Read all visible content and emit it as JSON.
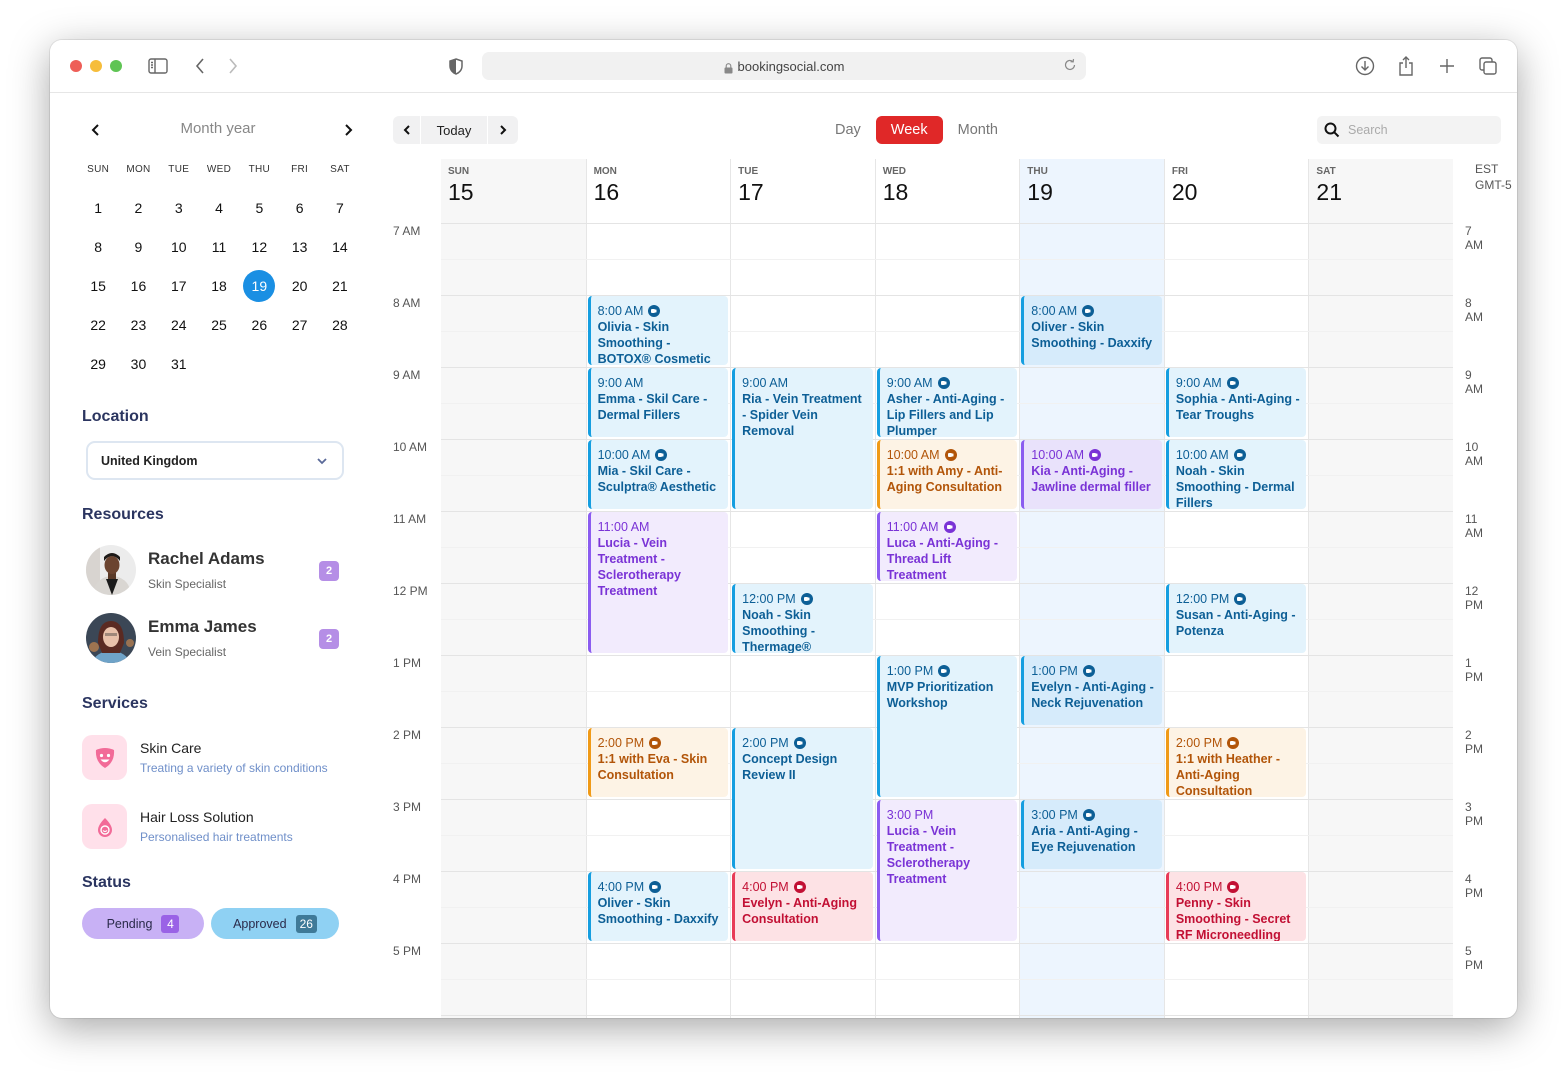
{
  "browser": {
    "url": "bookingsocial.com",
    "traffic_lights": {
      "close": "#ee5e57",
      "minimize": "#f6bd3b",
      "maximize": "#5fc454"
    }
  },
  "mini_calendar": {
    "title": "Month year",
    "weekdays": [
      "SUN",
      "MON",
      "TUE",
      "WED",
      "THU",
      "FRI",
      "SAT"
    ],
    "days": [
      "1",
      "2",
      "3",
      "4",
      "5",
      "6",
      "7",
      "8",
      "9",
      "10",
      "11",
      "12",
      "13",
      "14",
      "15",
      "16",
      "17",
      "18",
      "19",
      "20",
      "21",
      "22",
      "23",
      "24",
      "25",
      "26",
      "27",
      "28",
      "29",
      "30",
      "31"
    ],
    "selected_day": "19",
    "accent": "#1a8fe3"
  },
  "location": {
    "title": "Location",
    "selected": "United Kingdom"
  },
  "resources": {
    "title": "Resources",
    "items": [
      {
        "name": "Rachel Adams",
        "role": "Skin Specialist",
        "count": "2"
      },
      {
        "name": "Emma James",
        "role": "Vein Specialist",
        "count": "2"
      }
    ]
  },
  "services": {
    "title": "Services",
    "items": [
      {
        "name": "Skin Care",
        "description": "Treating a variety of skin conditions",
        "icon": "face-mask-icon"
      },
      {
        "name": "Hair Loss Solution",
        "description": "Personalised hair treatments",
        "icon": "droplet-face-icon"
      }
    ]
  },
  "status": {
    "title": "Status",
    "pending": {
      "label": "Pending",
      "count": "4",
      "color": "#c8b1f5"
    },
    "approved": {
      "label": "Approved",
      "count": "26",
      "color": "#8fd1f3"
    }
  },
  "toolbar": {
    "today_label": "Today",
    "views": [
      "Day",
      "Week",
      "Month"
    ],
    "active_view": "Week",
    "search_placeholder": "Search"
  },
  "week": {
    "timezone": [
      "EST",
      "GMT-5"
    ],
    "days": [
      {
        "dow": "SUN",
        "num": "15"
      },
      {
        "dow": "MON",
        "num": "16"
      },
      {
        "dow": "TUE",
        "num": "17"
      },
      {
        "dow": "WED",
        "num": "18"
      },
      {
        "dow": "THU",
        "num": "19"
      },
      {
        "dow": "FRI",
        "num": "20"
      },
      {
        "dow": "SAT",
        "num": "21"
      }
    ],
    "today_index": 4,
    "hours": [
      "7 AM",
      "8 AM",
      "9 AM",
      "10 AM",
      "11 AM",
      "12 PM",
      "1 PM",
      "2 PM",
      "3 PM",
      "4 PM",
      "5 PM"
    ],
    "events": [
      {
        "day": 1,
        "start": 8,
        "end": 9,
        "time": "8:00 AM",
        "video": true,
        "title": "Olivia - Skin Smoothing - BOTOX® Cosmetic",
        "style": "blue"
      },
      {
        "day": 1,
        "start": 9,
        "end": 10,
        "time": "9:00 AM",
        "video": false,
        "title": "Emma - Skil Care - Dermal Fillers",
        "style": "blue"
      },
      {
        "day": 1,
        "start": 10,
        "end": 11,
        "time": "10:00 AM",
        "video": true,
        "title": "Mia - Skil Care - Sculptra® Aesthetic",
        "style": "blue"
      },
      {
        "day": 1,
        "start": 11,
        "end": 13,
        "time": "11:00 AM",
        "video": false,
        "title": "Lucia - Vein Treatment - Sclerotherapy Treatment",
        "style": "purple"
      },
      {
        "day": 1,
        "start": 14,
        "end": 15,
        "time": "2:00 PM",
        "video": true,
        "title": "1:1 with Eva - Skin Consultation",
        "style": "orange"
      },
      {
        "day": 1,
        "start": 16,
        "end": 17,
        "time": "4:00 PM",
        "video": true,
        "title": "Oliver - Skin Smoothing - Daxxify",
        "style": "blue"
      },
      {
        "day": 2,
        "start": 9,
        "end": 11,
        "time": "9:00 AM",
        "video": false,
        "title": "Ria - Vein Treatment - Spider Vein Removal",
        "style": "blue"
      },
      {
        "day": 2,
        "start": 12,
        "end": 13,
        "time": "12:00 PM",
        "video": true,
        "title": "Noah - Skin Smoothing - Thermage®",
        "style": "blue"
      },
      {
        "day": 2,
        "start": 14,
        "end": 16,
        "time": "2:00 PM",
        "video": true,
        "title": "Concept Design Review II",
        "style": "blue"
      },
      {
        "day": 2,
        "start": 16,
        "end": 17,
        "time": "4:00 PM",
        "video": true,
        "title": "Evelyn - Anti-Aging Consultation",
        "style": "red"
      },
      {
        "day": 3,
        "start": 9,
        "end": 10,
        "time": "9:00 AM",
        "video": true,
        "title": "Asher - Anti-Aging - Lip Fillers and Lip Plumper",
        "style": "blue"
      },
      {
        "day": 3,
        "start": 10,
        "end": 11,
        "time": "10:00 AM",
        "video": true,
        "title": "1:1 with Amy - Anti-Aging Consultation",
        "style": "orange"
      },
      {
        "day": 3,
        "start": 11,
        "end": 12,
        "time": "11:00 AM",
        "video": true,
        "title": "Luca - Anti-Aging - Thread Lift Treatment",
        "style": "purple"
      },
      {
        "day": 3,
        "start": 13,
        "end": 15,
        "time": "1:00 PM",
        "video": true,
        "title": "MVP Prioritization Workshop",
        "style": "blue"
      },
      {
        "day": 3,
        "start": 15,
        "end": 17,
        "time": "3:00 PM",
        "video": false,
        "title": "Lucia - Vein Treatment - Sclerotherapy Treatment",
        "style": "purple"
      },
      {
        "day": 4,
        "start": 8,
        "end": 9,
        "time": "8:00 AM",
        "video": true,
        "title": "Oliver - Skin Smoothing - Daxxify",
        "style": "blue2"
      },
      {
        "day": 4,
        "start": 10,
        "end": 11,
        "time": "10:00 AM",
        "video": true,
        "title": "Kia - Anti-Aging - Jawline dermal filler",
        "style": "purple2"
      },
      {
        "day": 4,
        "start": 13,
        "end": 14,
        "time": "1:00 PM",
        "video": true,
        "title": "Evelyn - Anti-Aging - Neck Rejuvenation",
        "style": "blue2"
      },
      {
        "day": 4,
        "start": 15,
        "end": 16,
        "time": "3:00 PM",
        "video": true,
        "title": "Aria - Anti-Aging - Eye Rejuvenation",
        "style": "blue2"
      },
      {
        "day": 5,
        "start": 9,
        "end": 10,
        "time": "9:00 AM",
        "video": true,
        "title": "Sophia - Anti-Aging - Tear Troughs",
        "style": "blue"
      },
      {
        "day": 5,
        "start": 10,
        "end": 11,
        "time": "10:00 AM",
        "video": true,
        "title": "Noah - Skin Smoothing - Dermal Fillers",
        "style": "blue"
      },
      {
        "day": 5,
        "start": 12,
        "end": 13,
        "time": "12:00 PM",
        "video": true,
        "title": "Susan - Anti-Aging - Potenza",
        "style": "blue"
      },
      {
        "day": 5,
        "start": 14,
        "end": 15,
        "time": "2:00 PM",
        "video": true,
        "title": "1:1 with Heather - Anti-Aging Consultation",
        "style": "orange"
      },
      {
        "day": 5,
        "start": 16,
        "end": 17,
        "time": "4:00 PM",
        "video": true,
        "title": "Penny - Skin Smoothing - Secret RF Microneedling",
        "style": "red"
      }
    ]
  }
}
